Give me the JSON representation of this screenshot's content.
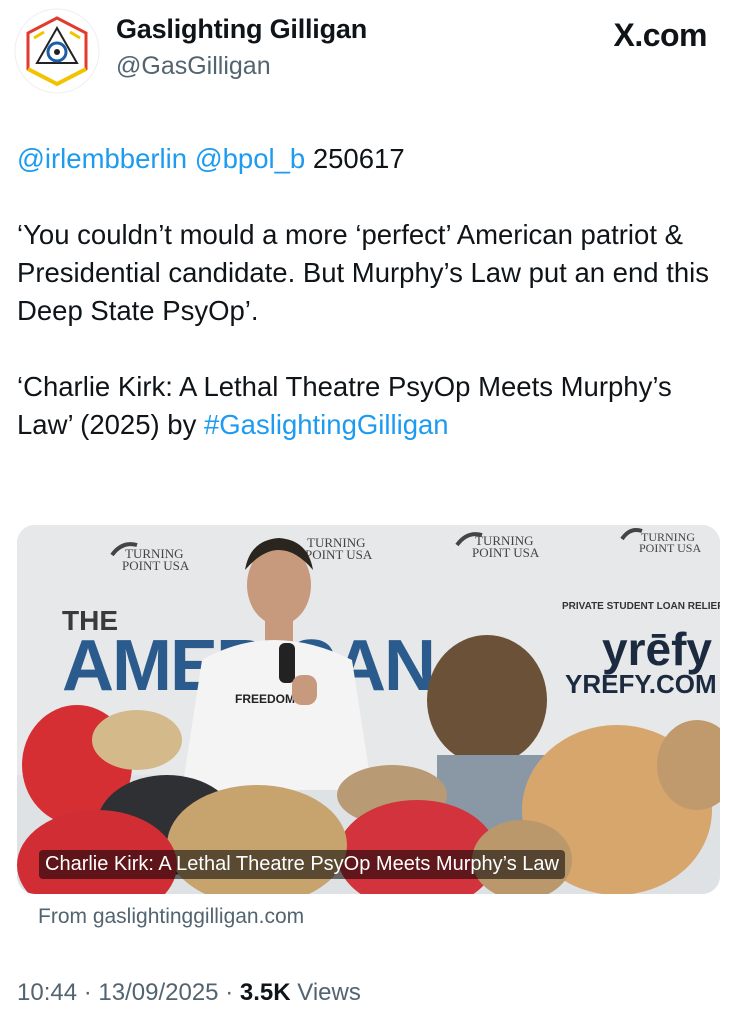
{
  "author": {
    "name": "Gaslighting Gilligan",
    "handle": "@GasGilligan"
  },
  "brand": "X.com",
  "tweet": {
    "mention1": "@irlembberlin",
    "mention2": "@bpol_b",
    "code": "250617",
    "para1": "‘You couldn’t mould a more ‘perfect’ American patriot & Presidential candidate. But Murphy’s Law put an end this Deep State PsyOp’.",
    "para2_text": "‘Charlie Kirk: A Lethal Theatre PsyOp Meets Murphy’s Law’ (2025) by ",
    "hashtag": "#GaslightingGilligan"
  },
  "card": {
    "caption": "Charlie Kirk: A Lethal Theatre PsyOp Meets Murphy’s Law",
    "signs": {
      "turning": "TURNING",
      "point": "POINT USA",
      "the": "THE",
      "big_letters": "AMERICAN",
      "sponsor_line": "PRIVATE STUDENT LOAN RELIEF",
      "sponsor_brand": "yrēfy",
      "sponsor_url": "YREFY.COM",
      "shirt": "FREEDOM"
    },
    "from_label": "From gaslightinggilligan.com"
  },
  "meta": {
    "time": "10:44",
    "date": "13/09/2025",
    "views_count": "3.5K",
    "views_label": "Views",
    "sep": "·"
  },
  "colors": {
    "link": "#1d9bf0",
    "muted": "#536471",
    "text": "#0f1419"
  }
}
